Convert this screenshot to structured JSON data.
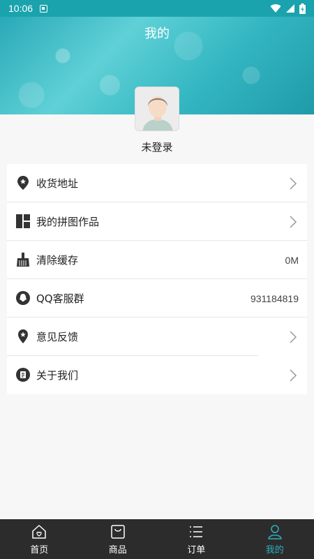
{
  "status_bar": {
    "time": "10:06"
  },
  "header": {
    "title": "我的"
  },
  "profile": {
    "login_text": "未登录"
  },
  "menu": [
    {
      "label": "收货地址",
      "icon": "location-icon",
      "value": "",
      "chevron": true
    },
    {
      "label": "我的拼图作品",
      "icon": "puzzle-grid-icon",
      "value": "",
      "chevron": true
    },
    {
      "label": "清除缓存",
      "icon": "broom-icon",
      "value": "0M",
      "chevron": false
    },
    {
      "label": "QQ客服群",
      "icon": "qq-icon",
      "value": "931184819",
      "chevron": false
    },
    {
      "label": "意见反馈",
      "icon": "feedback-pin-icon",
      "value": "",
      "chevron": true
    },
    {
      "label": "关于我们",
      "icon": "about-icon",
      "value": "",
      "chevron": true
    }
  ],
  "bottom_nav": [
    {
      "label": "首页",
      "icon": "home-icon",
      "active": false
    },
    {
      "label": "商品",
      "icon": "shopping-bag-icon",
      "active": false
    },
    {
      "label": "订单",
      "icon": "list-icon",
      "active": false
    },
    {
      "label": "我的",
      "icon": "person-icon",
      "active": true
    }
  ],
  "colors": {
    "accent": "#2bb0c0",
    "nav_bg": "#2c2c2c",
    "status_bar": "#1aa3ad"
  }
}
